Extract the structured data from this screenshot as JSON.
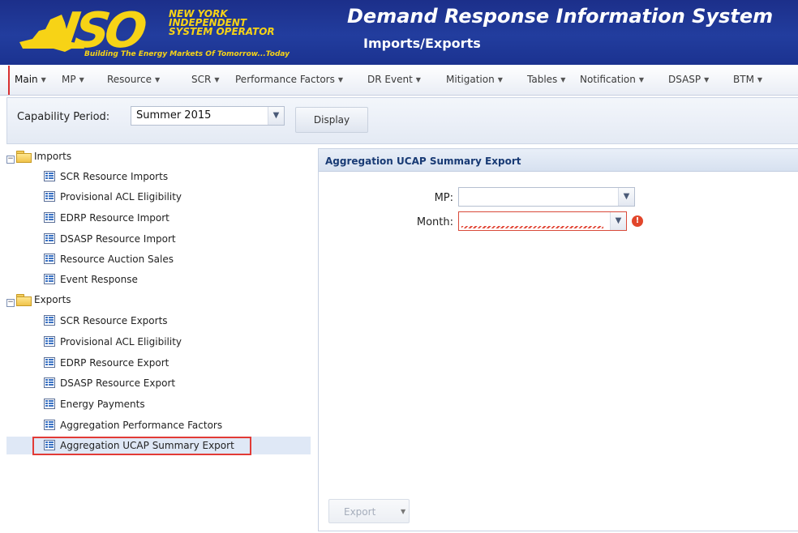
{
  "header": {
    "logo_line1": "NEW YORK",
    "logo_line2": "INDEPENDENT",
    "logo_line3": "SYSTEM OPERATOR",
    "logo_letters": "ISO",
    "logo_tagline": "Building The Energy Markets Of Tomorrow...Today",
    "app_title": "Demand Response Information System",
    "page_subtitle": "Imports/Exports",
    "colors": {
      "background": "#223d9e",
      "logo": "#f7d316"
    }
  },
  "menu": {
    "items": [
      {
        "label": "Main"
      },
      {
        "label": "MP"
      },
      {
        "label": "Resource"
      },
      {
        "label": "SCR"
      },
      {
        "label": "Performance Factors"
      },
      {
        "label": "DR Event"
      },
      {
        "label": "Mitigation"
      },
      {
        "label": "Tables"
      },
      {
        "label": "Notification"
      },
      {
        "label": "DSASP"
      },
      {
        "label": "BTM"
      }
    ]
  },
  "toolbar": {
    "capability_label": "Capability Period:",
    "capability_value": "Summer 2015",
    "display_label": "Display"
  },
  "tree": {
    "imports_label": "Imports",
    "imports": [
      "SCR Resource Imports",
      "Provisional ACL Eligibility",
      "EDRP Resource Import",
      "DSASP Resource Import",
      "Resource Auction Sales",
      "Event Response"
    ],
    "exports_label": "Exports",
    "exports": [
      "SCR Resource Exports",
      "Provisional ACL Eligibility",
      "EDRP Resource Export",
      "DSASP Resource Export",
      "Energy Payments",
      "Aggregation Performance Factors",
      "Aggregation UCAP Summary Export"
    ],
    "selected": "Aggregation UCAP Summary Export",
    "highlight_color": "#e23b36"
  },
  "panel": {
    "title": "Aggregation UCAP Summary Export",
    "mp_label": "MP:",
    "mp_value": "",
    "month_label": "Month:",
    "month_value": "",
    "error_icon": "!",
    "export_label": "Export"
  }
}
